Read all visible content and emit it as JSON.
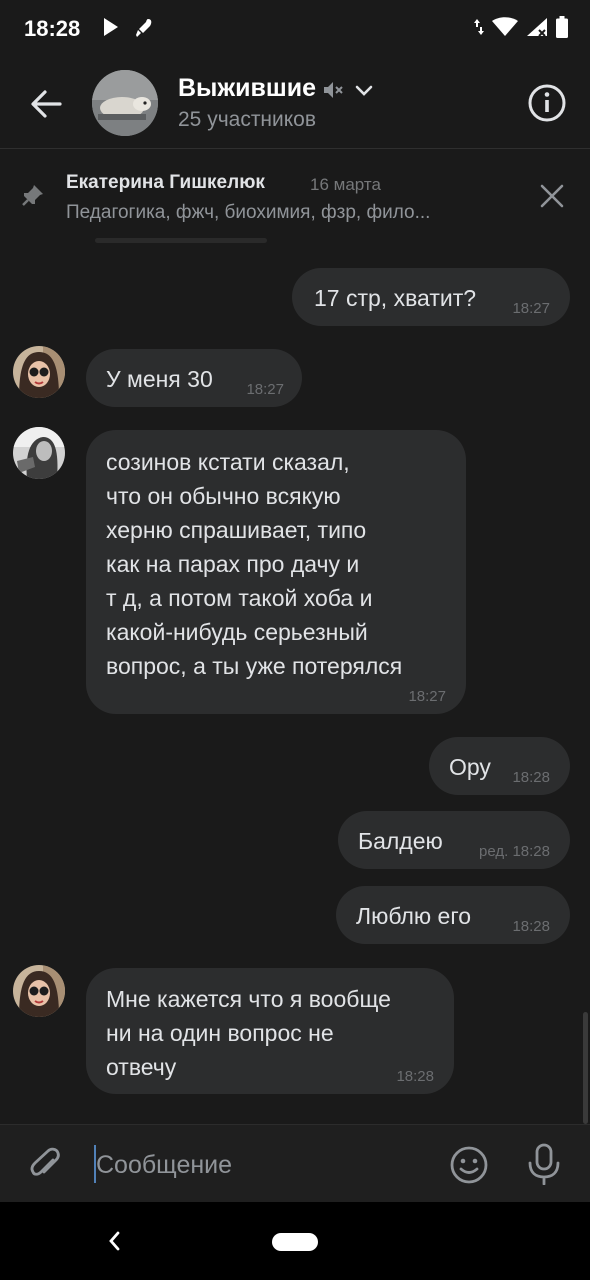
{
  "status_bar": {
    "time": "18:28"
  },
  "header": {
    "title": "Выжившие",
    "subtitle": "25 участников"
  },
  "pinned": {
    "author": "Екатерина Гишкелюк",
    "date": "16 марта",
    "text": "Педагогика, фжч, биохимия, фзр, фило..."
  },
  "messages": [
    {
      "side": "out",
      "text": "17 стр, хватит?",
      "time": "18:27"
    },
    {
      "side": "in",
      "text": "У меня 30",
      "time": "18:27"
    },
    {
      "side": "in",
      "lines": [
        "созинов кстати сказал,",
        "что он обычно всякую",
        "херню спрашивает, типо",
        "как на парах про дачу и",
        "т д, а потом такой хоба и",
        "какой-нибудь серьезный",
        "вопрос, а ты уже потерялся"
      ],
      "time": "18:27"
    },
    {
      "side": "out",
      "text": "Ору",
      "time": "18:28"
    },
    {
      "side": "out",
      "text": "Балдею",
      "time": "ред. 18:28"
    },
    {
      "side": "out",
      "text": "Люблю его",
      "time": "18:28"
    },
    {
      "side": "in",
      "lines": [
        "Мне кажется что я вообще",
        "ни на один вопрос не",
        "отвечу"
      ],
      "time": "18:28"
    }
  ],
  "composer": {
    "placeholder": "Сообщение"
  },
  "colors": {
    "accent": "#5181b8",
    "bubble": "#2c2d2e",
    "background": "#1a1a1a"
  }
}
